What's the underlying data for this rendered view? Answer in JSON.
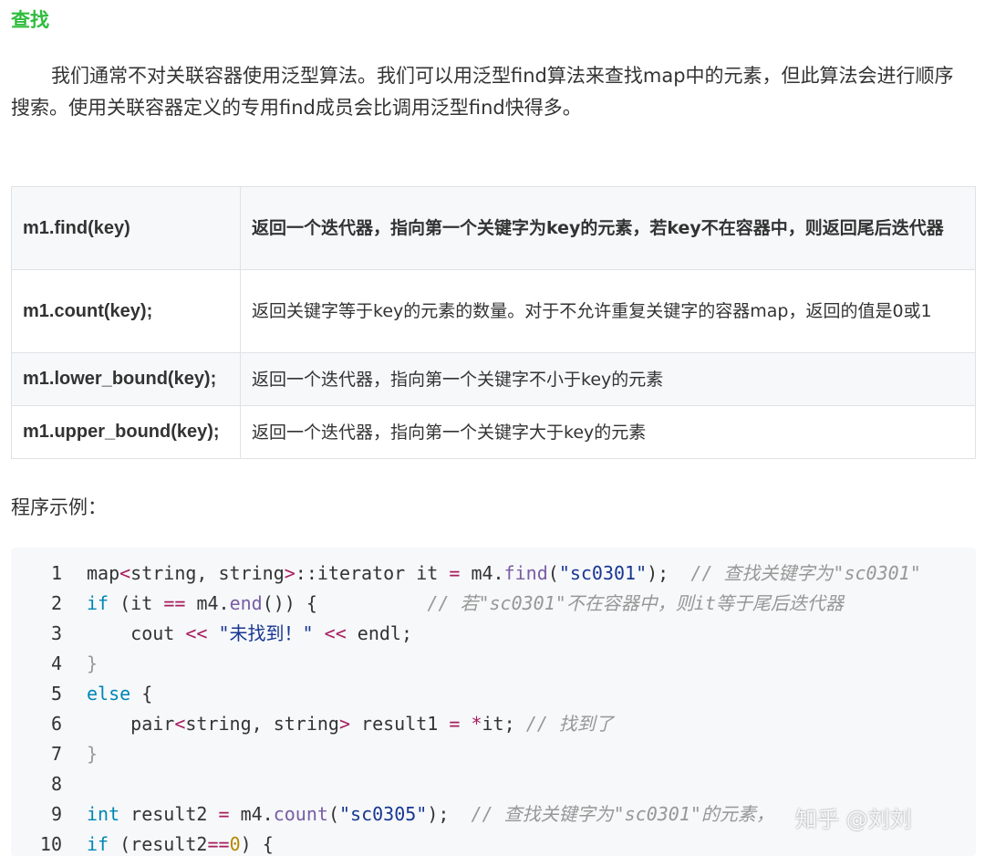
{
  "heading": "查找",
  "paragraph": "我们通常不对关联容器使用泛型算法。我们可以用泛型find算法来查找map中的元素，但此算法会进行顺序搜索。使用关联容器定义的专用find成员会比调用泛型find快得多。",
  "table": [
    {
      "method": "m1.find(key)",
      "desc": "返回一个迭代器，指向第一个关键字为key的元素，若key不在容器中，则返回尾后迭代器"
    },
    {
      "method": "m1.count(key);",
      "desc": "返回关键字等于key的元素的数量。对于不允许重复关键字的容器map，返回的值是0或1"
    },
    {
      "method": "m1.lower_bound(key);",
      "desc": "返回一个迭代器，指向第一个关键字不小于key的元素"
    },
    {
      "method": "m1.upper_bound(key);",
      "desc": "返回一个迭代器，指向第一个关键字大于key的元素"
    }
  ],
  "caption": "程序示例：",
  "code": {
    "line_numbers": [
      "1",
      "2",
      "3",
      "4",
      "5",
      "6",
      "7",
      "8",
      "9",
      "10"
    ],
    "l1": {
      "a": "map",
      "lt": "<",
      "b": "string, string",
      "gt": ">",
      "c": "::iterator it ",
      "eq": "=",
      "d": " m4.",
      "fn": "find",
      "e": "(",
      "str": "\"sc0301\"",
      "f": ");  ",
      "cm": "// 查找关键字为\"sc0301\""
    },
    "l2": {
      "kw": "if",
      "a": " (it ",
      "op": "==",
      "b": " m4.",
      "fn": "end",
      "c": "()) {          ",
      "cm": "// 若\"sc0301\"不在容器中，则it等于尾后迭代器"
    },
    "l3": {
      "a": "    cout ",
      "op1": "<<",
      "sp": " ",
      "str": "\"未找到！\"",
      "sp2": " ",
      "op2": "<<",
      "b": " endl;"
    },
    "l4": {
      "a": "}"
    },
    "l5": {
      "kw": "else",
      "a": " {"
    },
    "l6": {
      "a": "    pair",
      "lt": "<",
      "b": "string, string",
      "gt": ">",
      "c": " result1 ",
      "eq": "=",
      "d": " ",
      "op": "*",
      "e": "it; ",
      "cm": "// 找到了"
    },
    "l7": {
      "a": "}"
    },
    "l8": {
      "a": ""
    },
    "l9": {
      "kw": "int",
      "a": " result2 ",
      "eq": "=",
      "b": " m4.",
      "fn": "count",
      "c": "(",
      "str": "\"sc0305\"",
      "d": ");  ",
      "cm": "// 查找关键字为\"sc0301\"的元素，"
    },
    "l10": {
      "kw": "if",
      "a": " (result2",
      "op": "==",
      "num": "0",
      "b": ") {"
    }
  },
  "watermark": "知乎 @刘刘"
}
